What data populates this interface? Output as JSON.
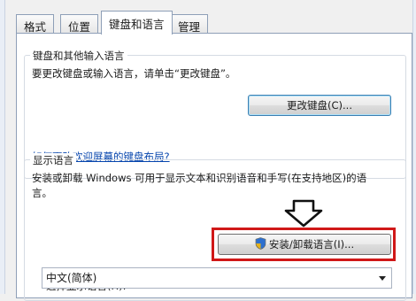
{
  "tabs": [
    {
      "label": "格式"
    },
    {
      "label": "位置"
    },
    {
      "label": "键盘和语言"
    },
    {
      "label": "管理"
    }
  ],
  "keyboard_group": {
    "title": "键盘和其他输入语言",
    "description": "要更改键盘或输入语言，请单击“更改键盘”。",
    "change_keyboard_button": "更改键盘(C)...",
    "help_link": "如何更改欢迎屏幕的键盘布局?"
  },
  "display_group": {
    "title": "显示语言",
    "description_line1": "安装或卸载 Windows 可用于显示文本和识别语音和手写(在支持地区)的语",
    "description_line2": "言。",
    "install_button": "安装/卸载语言(I)...",
    "select_label": "选择显示语言(H):",
    "select_value": "中文(简体)"
  },
  "colors": {
    "highlight": "#d01818",
    "link": "#0645ad"
  },
  "icons": {
    "install_button_icon": "uac-shield-icon",
    "annotation_arrow": "down-arrow-icon"
  }
}
